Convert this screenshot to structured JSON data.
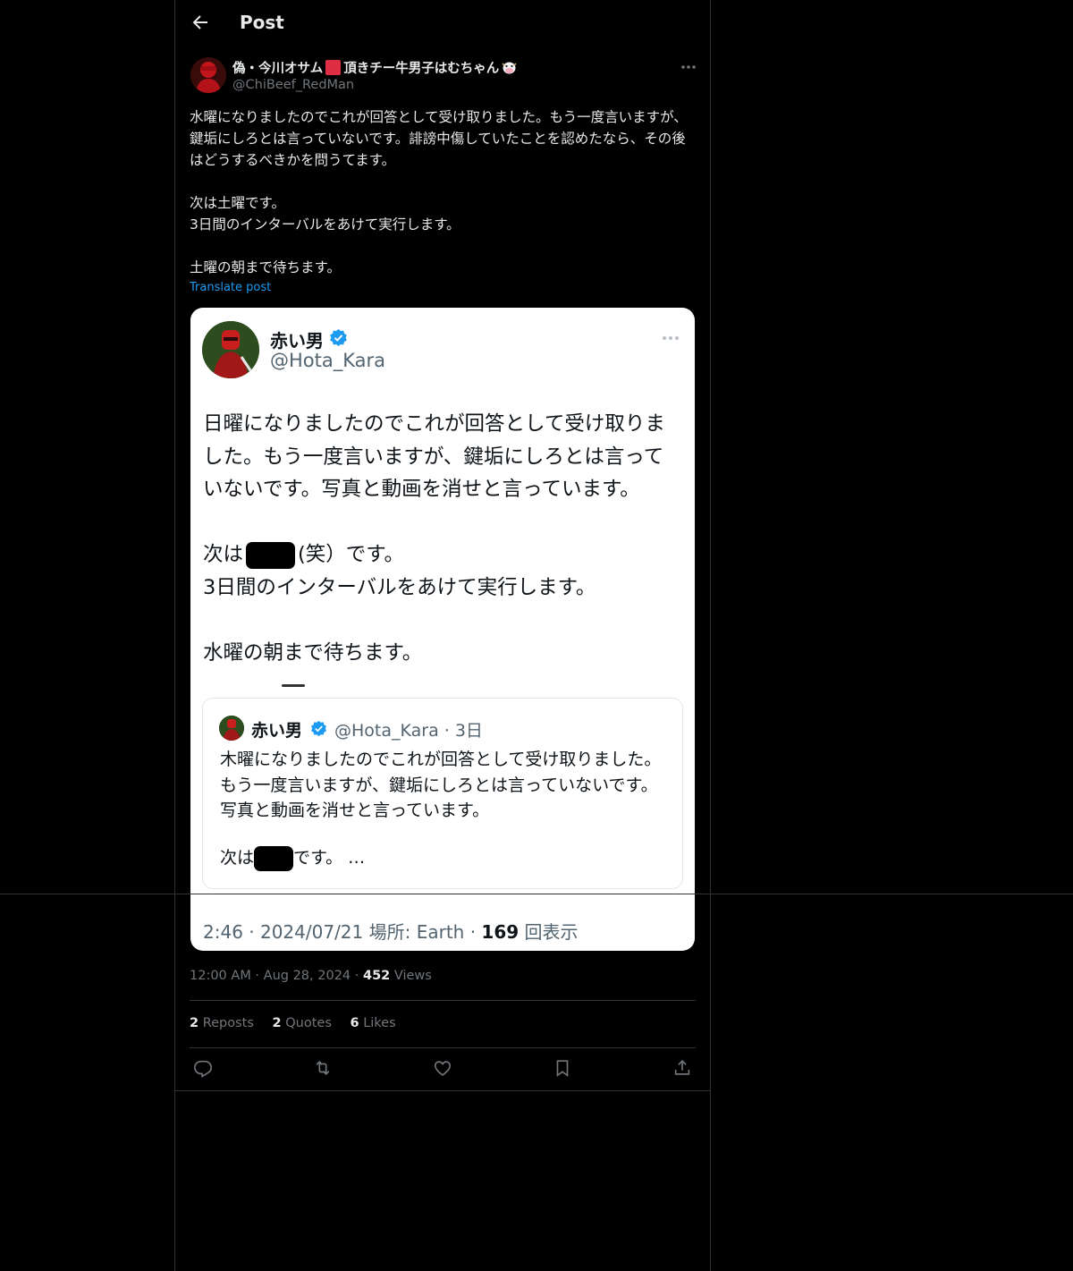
{
  "header": {
    "title": "Post"
  },
  "post": {
    "display_name": "偽・今川オサム",
    "display_name_suffix": "頂きチー牛男子はむちゃん",
    "handle": "@ChiBeef_RedMan",
    "text": "水曜になりましたのでこれが回答として受け取りました。もう一度言いますが、鍵垢にしろとは言っていないです。誹謗中傷していたことを認めたなら、その後はどうするべきかを問うてます。\n\n次は土曜です。\n3日間のインターバルをあけて実行します。\n\n土曜の朝まで待ちます。",
    "translate_label": "Translate post",
    "time": "12:00 AM",
    "date": "Aug 28, 2024",
    "views_count": "452",
    "views_label": "Views",
    "reposts_count": "2",
    "reposts_label": "Reposts",
    "quotes_count": "2",
    "quotes_label": "Quotes",
    "likes_count": "6",
    "likes_label": "Likes"
  },
  "embedded_screenshot": {
    "name": "赤い男",
    "handle": "@Hota_Kara",
    "text_main": "日曜になりましたのでこれが回答として受け取りました。もう一度言いますが、鍵垢にしろとは言っていないです。写真と動画を消せと言っています。",
    "line_next_prefix": "次は",
    "line_next_suffix": "(笑）です。",
    "line_interval": "3日間のインターバルをあけて実行します。",
    "line_wait": "水曜の朝まで待ちます。",
    "quote": {
      "name": "赤い男",
      "handle_date": "@Hota_Kara · 3日",
      "text": "木曜になりましたのでこれが回答として受け取りました。もう一度言いますが、鍵垢にしろとは言っていないです。写真と動画を消せと言っています。",
      "last_prefix": "次は",
      "last_suffix": "です。 …"
    },
    "meta_time": "2:46 · 2024/07/21 場所: Earth ·",
    "meta_views_count": "169",
    "meta_views_label": "回表示"
  },
  "colors": {
    "background": "#000000",
    "text": "#e7e9ea",
    "muted": "#71767b",
    "link": "#1d9bf0",
    "verified": "#1d9bf0"
  },
  "icons": [
    "back-arrow-icon",
    "more-icon",
    "verified-icon",
    "reply-icon",
    "repost-icon",
    "like-icon",
    "bookmark-icon",
    "share-icon"
  ]
}
